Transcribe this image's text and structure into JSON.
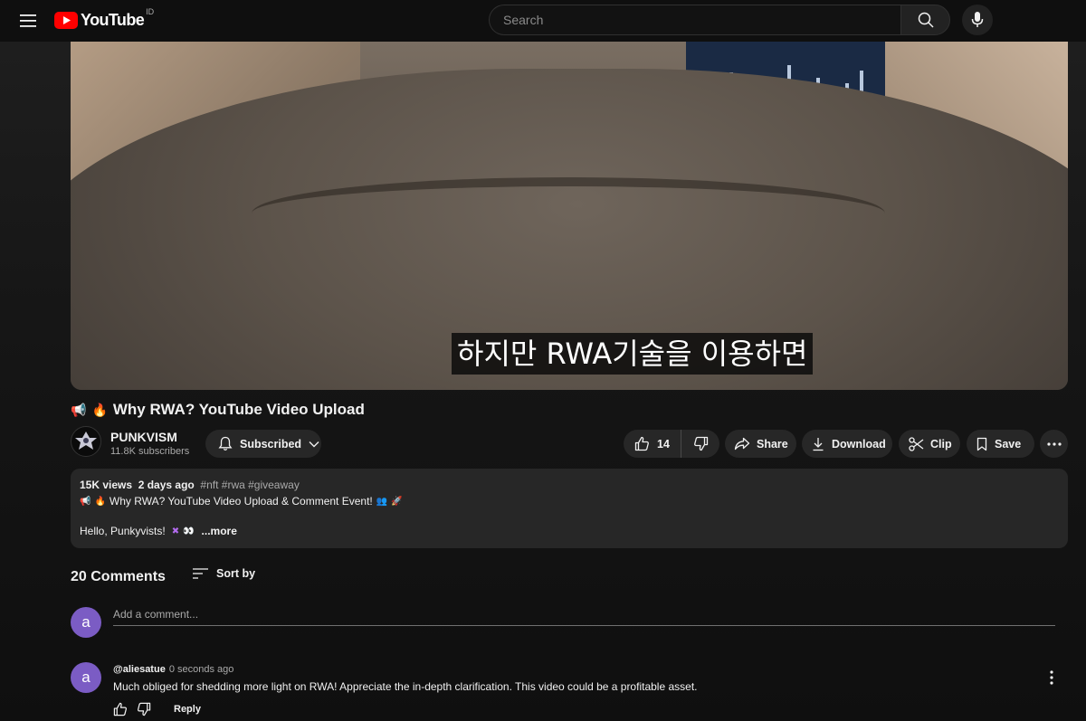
{
  "header": {
    "logo_text": "YouTube",
    "country_code": "ID",
    "search_placeholder": "Search"
  },
  "video": {
    "subtitle": "하지만 RWA기술을 이용하면",
    "title": "Why RWA? YouTube Video Upload"
  },
  "channel": {
    "name": "PUNKVISM",
    "subscribers": "11.8K subscribers",
    "subscribe_label": "Subscribed"
  },
  "actions": {
    "likes": "14",
    "share": "Share",
    "download": "Download",
    "clip": "Clip",
    "save": "Save"
  },
  "description": {
    "views": "15K views",
    "date": "2 days ago",
    "tags": "#nft #rwa #giveaway",
    "line1": "Why RWA? YouTube Video Upload & Comment Event!",
    "line2": "Hello, Punkyvists!",
    "more": "...more"
  },
  "comments": {
    "count": "20 Comments",
    "sort_label": "Sort by",
    "add_placeholder": "Add a comment...",
    "user_initial": "a",
    "items": [
      {
        "initial": "a",
        "author": "@aliesatue",
        "time": "0 seconds ago",
        "text": "Much obliged for shedding more light on RWA! Appreciate the in-depth clarification. This video could be a profitable asset.",
        "reply_label": "Reply"
      }
    ]
  },
  "colors": {
    "brand_red": "#ff0000",
    "avatar_purple": "#7b5cc4",
    "pill_bg": "#272727"
  }
}
